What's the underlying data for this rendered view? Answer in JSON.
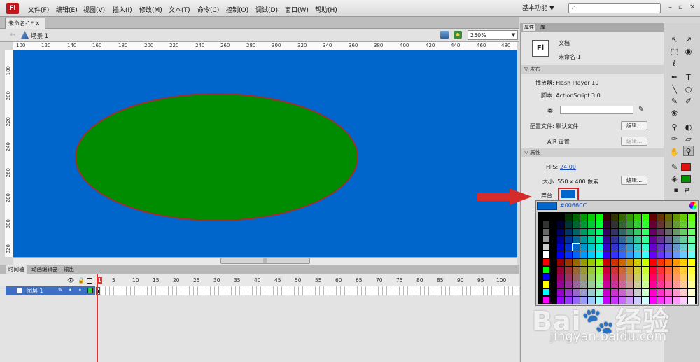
{
  "app": {
    "logo": "Fl"
  },
  "menu": [
    "文件(F)",
    "编辑(E)",
    "视图(V)",
    "插入(I)",
    "修改(M)",
    "文本(T)",
    "命令(C)",
    "控制(O)",
    "调试(D)",
    "窗口(W)",
    "帮助(H)"
  ],
  "workspace": {
    "label": "基本功能 ▼"
  },
  "window_buttons": [
    "–",
    "▫",
    "✕"
  ],
  "document": {
    "tab_label": "未命名-1* ✕",
    "scene_label": "场景 1",
    "zoom": "250%"
  },
  "ruler": {
    "top": [
      "100",
      "120",
      "140",
      "160",
      "180",
      "200",
      "220",
      "240",
      "260",
      "280",
      "300",
      "320",
      "340",
      "360",
      "380",
      "400",
      "420",
      "440",
      "460",
      "480"
    ],
    "left": [
      "180",
      "200",
      "220",
      "240",
      "260",
      "280",
      "300",
      "320"
    ]
  },
  "colors": {
    "stage": "#0066cc",
    "ellipse_fill": "#008c00",
    "ellipse_stroke": "#a32c2c",
    "highlight": "#d02020"
  },
  "timeline": {
    "tabs": [
      "时间轴",
      "动画编辑器",
      "输出"
    ],
    "frame_numbers": [
      "1",
      "5",
      "10",
      "15",
      "20",
      "25",
      "30",
      "35",
      "40",
      "45",
      "50",
      "55",
      "60",
      "65",
      "70",
      "75",
      "80",
      "85",
      "90",
      "95",
      "100"
    ],
    "layer_name": "图层 1"
  },
  "properties": {
    "tabs": [
      "属性",
      "库"
    ],
    "doc_icon": "Fl",
    "doc_type": "文档",
    "doc_name": "未命名-1",
    "publish_section": "▽ 发布",
    "player_label": "播放器: Flash Player 10",
    "script_label": "脚本: ActionScript 3.0",
    "class_label": "类:",
    "profile_label": "配置文件: 默认文件",
    "air_label": "AIR 设置",
    "edit_button": "编辑...",
    "props_section": "▽ 属性",
    "fps_label": "FPS:",
    "fps_value": "24.00",
    "size_label": "大小: 550 x 400 像素",
    "stage_label": "舞台:"
  },
  "color_picker": {
    "hex": "#0066CC"
  },
  "tools": [
    "↖",
    "↗",
    "⬚",
    "◉",
    "ℓ",
    "◇",
    "T",
    "╲",
    "○",
    "✎",
    "✐",
    "◎",
    "▣",
    "◐",
    "✋",
    "🔍",
    "✎",
    "◐",
    "▪"
  ],
  "watermark": {
    "brand": "Bai🐾经验",
    "url": "jingyan.baidu.com"
  }
}
